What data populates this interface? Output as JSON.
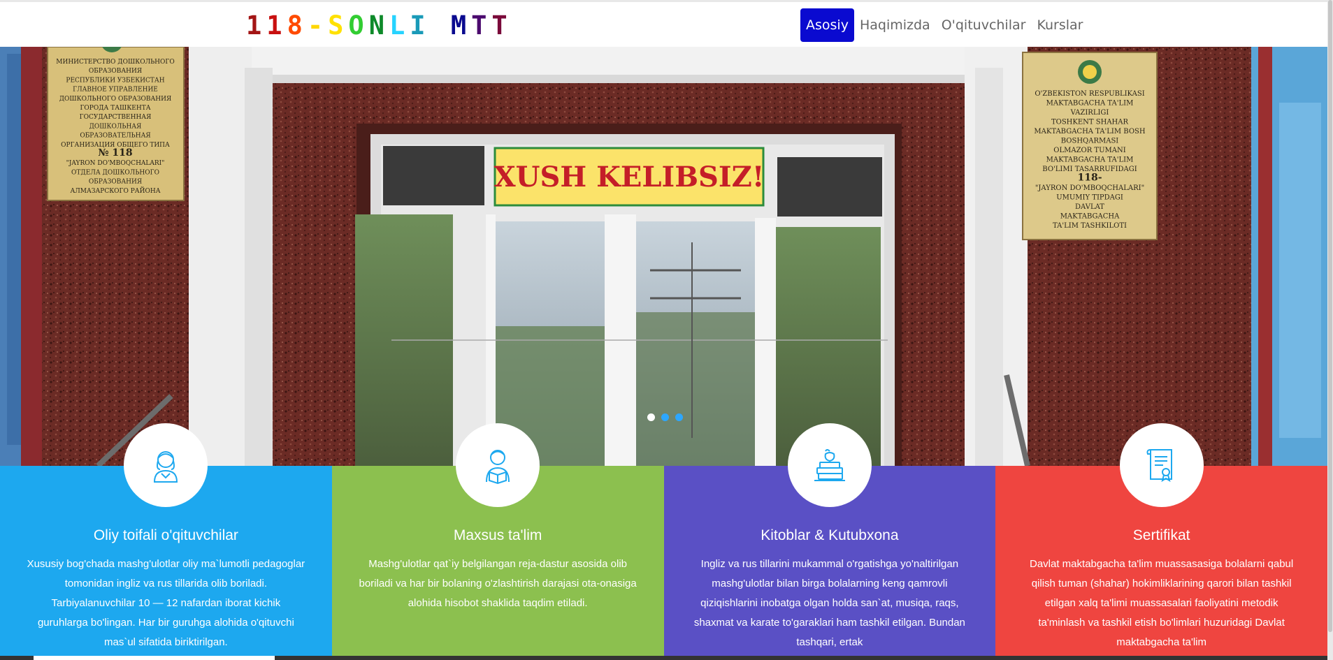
{
  "brand": {
    "letters": [
      {
        "ch": "1",
        "color": "#a31515"
      },
      {
        "ch": "1",
        "color": "#c81010"
      },
      {
        "ch": "8",
        "color": "#ff4b00"
      },
      {
        "ch": "-",
        "color": "#ffd700"
      },
      {
        "ch": "S",
        "color": "#ffe100"
      },
      {
        "ch": "O",
        "color": "#32cd32"
      },
      {
        "ch": "N",
        "color": "#0e8a2a"
      },
      {
        "ch": "L",
        "color": "#27d3ff"
      },
      {
        "ch": "I",
        "color": "#1a9ab8"
      },
      {
        "ch": " ",
        "color": "#000000"
      },
      {
        "ch": "M",
        "color": "#0a0a8f"
      },
      {
        "ch": "T",
        "color": "#4b0a6e"
      },
      {
        "ch": "T",
        "color": "#7a0a3a"
      }
    ]
  },
  "nav": {
    "items": [
      {
        "label": "Asosiy",
        "active": true
      },
      {
        "label": "Haqimizda",
        "active": false
      },
      {
        "label": "O'qituvchilar",
        "active": false
      },
      {
        "label": "Kurslar",
        "active": false
      }
    ],
    "active_color": "#0a0ad0"
  },
  "hero": {
    "banner_text": "XUSH KELIBSIZ!",
    "left_plaque": [
      "МИНИСТЕРСТВО ДОШКОЛЬНОГО",
      "ОБРАЗОВАНИЯ",
      "РЕСПУБЛИКИ УЗБЕКИСТАН",
      "ГЛАВНОЕ УПРАВЛЕНИЕ",
      "ДОШКОЛЬНОГО ОБРАЗОВАНИЯ",
      "ГОРОДА ТАШКЕНТА",
      "ГОСУДАРСТВЕННАЯ",
      "ДОШКОЛЬНАЯ",
      "ОБРАЗОВАТЕЛЬНАЯ",
      "ОРГАНИЗАЦИЯ ОБЩЕГО ТИПА",
      "№ 118",
      "\"JAYRON DO'MBOQCHALARI\"",
      "ОТДЕЛА ДОШКОЛЬНОГО",
      "ОБРАЗОВАНИЯ",
      "АЛМАЗАРСКОГО РАЙОНА"
    ],
    "right_plaque": [
      "O'ZBEKISTON RESPUBLIKASI",
      "MAKTABGACHA TA'LIM",
      "VAZIRLIGI",
      "TOSHKENT SHAHAR",
      "MAKTABGACHA TA'LIM BOSH",
      "BOSHQARMASI",
      "OLMAZOR TUMANI",
      "MAKTABGACHA TA'LIM",
      "BO'LIMI TASARRUFIDAGI",
      "118-",
      "\"JAYRON DO'MBOQCHALARI\"",
      "UMUMIY TIPDAGI",
      "DAVLAT",
      "MAKTABGACHA",
      "TA'LIM TASHKILOTI"
    ],
    "indicators": [
      true,
      false,
      false
    ]
  },
  "features": [
    {
      "icon": "teacher-icon",
      "title": "Oliy toifali o'qituvchilar",
      "text": "Xususiy bog'chada mashg'ulotlar oliy ma`lumotli pedagoglar tomonidan ingliz va rus tillarida olib boriladi. Tarbiyalanuvchilar 10 — 12 nafardan iborat kichik guruhlarga bo'lingan. Har bir guruhga alohida o'qituvchi mas`ul sifatida biriktirilgan.",
      "color": "#1da8ef"
    },
    {
      "icon": "student-reading-icon",
      "title": "Maxsus ta'lim",
      "text": "Mashg'ulotlar qat`iy belgilangan reja-dastur asosida olib boriladi va har bir bolaning o'zlashtirish darajasi ota-onasiga alohida hisobot shaklida taqdim etiladi.",
      "color": "#8cc04f"
    },
    {
      "icon": "books-apple-icon",
      "title": "Kitoblar & Kutubxona",
      "text": "Ingliz va rus tillarini mukammal o'rgatishga yo'naltirilgan mashg'ulotlar bilan birga bolalarning keng qamrovli qiziqishlarini inobatga olgan holda san`at, musiqa, raqs, shaxmat va karate to'garaklari ham tashkil etilgan. Bundan tashqari, ertak",
      "color": "#5a50c5"
    },
    {
      "icon": "certificate-icon",
      "title": "Sertifikat",
      "text": "Davlat maktabgacha ta'lim muassasasiga bolalarni qabul qilish tuman (shahar) hokimliklarining qarori bilan tashkil etilgan xalq ta'limi muassasalari faoliyatini metodik ta'minlash va tashkil etish bo'limlari huzuridagi Davlat maktabgacha ta'lim",
      "color": "#ef4540"
    }
  ]
}
